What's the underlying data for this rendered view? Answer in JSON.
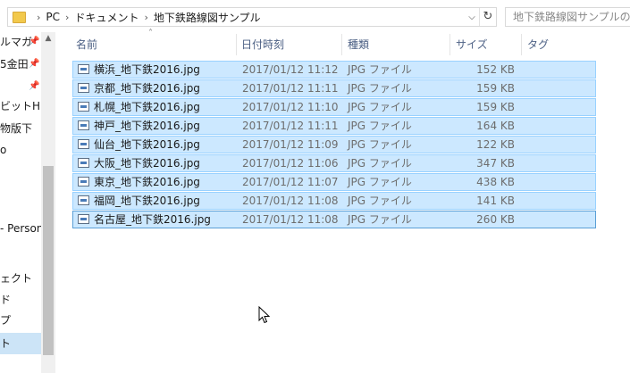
{
  "address": {
    "crumbs": [
      "PC",
      "ドキュメント",
      "地下鉄路線図サンプル"
    ],
    "dropdown_icon": "chevron-down-icon",
    "refresh_icon": "refresh-icon"
  },
  "search": {
    "placeholder": "地下鉄路線図サンプルの検"
  },
  "nav": {
    "items": [
      {
        "label": "ルマガ",
        "pinned": true
      },
      {
        "label": "5金田",
        "pinned": true
      },
      {
        "label": "",
        "pinned": true
      },
      {
        "label": "ビットHPマ",
        "pinned": false
      },
      {
        "label": "物版下",
        "pinned": false
      },
      {
        "label": "o",
        "pinned": false
      },
      {
        "label": "- Persona",
        "pinned": false
      },
      {
        "label": "ェクト",
        "pinned": false
      },
      {
        "label": "ド",
        "pinned": false
      },
      {
        "label": "プ",
        "pinned": false
      },
      {
        "label": "ト",
        "pinned": false,
        "selected": true
      }
    ]
  },
  "columns": {
    "name": "名前",
    "date": "日付時刻",
    "type": "種類",
    "size": "サイズ",
    "tag": "タグ"
  },
  "files": [
    {
      "name": "横浜_地下鉄2016.jpg",
      "date": "2017/01/12 11:12",
      "type": "JPG ファイル",
      "size": "152 KB"
    },
    {
      "name": "京都_地下鉄2016.jpg",
      "date": "2017/01/12 11:11",
      "type": "JPG ファイル",
      "size": "159 KB"
    },
    {
      "name": "札幌_地下鉄2016.jpg",
      "date": "2017/01/12 11:10",
      "type": "JPG ファイル",
      "size": "159 KB"
    },
    {
      "name": "神戸_地下鉄2016.jpg",
      "date": "2017/01/12 11:11",
      "type": "JPG ファイル",
      "size": "164 KB"
    },
    {
      "name": "仙台_地下鉄2016.jpg",
      "date": "2017/01/12 11:09",
      "type": "JPG ファイル",
      "size": "122 KB"
    },
    {
      "name": "大阪_地下鉄2016.jpg",
      "date": "2017/01/12 11:06",
      "type": "JPG ファイル",
      "size": "347 KB"
    },
    {
      "name": "東京_地下鉄2016.jpg",
      "date": "2017/01/12 11:07",
      "type": "JPG ファイル",
      "size": "438 KB"
    },
    {
      "name": "福岡_地下鉄2016.jpg",
      "date": "2017/01/12 11:08",
      "type": "JPG ファイル",
      "size": "141 KB"
    },
    {
      "name": "名古屋_地下鉄2016.jpg",
      "date": "2017/01/12 11:08",
      "type": "JPG ファイル",
      "size": "260 KB"
    }
  ],
  "colors": {
    "selection_fill": "#cce8ff",
    "selection_border": "#99d1ff",
    "header_text": "#4d6185"
  }
}
